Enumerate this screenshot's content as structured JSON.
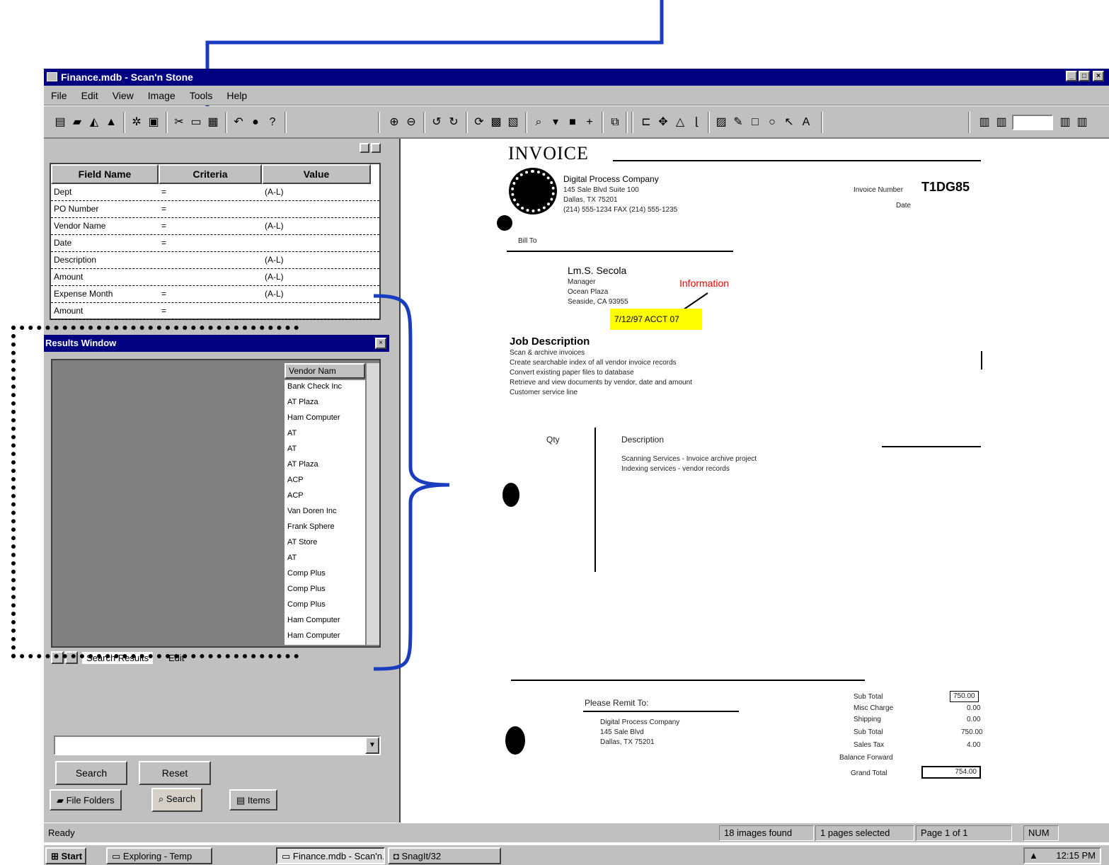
{
  "window": {
    "title": "Finance.mdb - Scan'n Stone",
    "min": "_",
    "max": "□",
    "close": "×"
  },
  "menu": [
    "File",
    "Edit",
    "View",
    "Image",
    "Tools",
    "Help"
  ],
  "grid": {
    "headers": [
      "Field Name",
      "Criteria",
      "Value"
    ],
    "rows": [
      {
        "field": "Dept",
        "criteria": "=",
        "value": "(A-L)"
      },
      {
        "field": "PO Number",
        "criteria": "=",
        "value": ""
      },
      {
        "field": "Vendor Name",
        "criteria": "=",
        "value": "(A-L)"
      },
      {
        "field": "Date",
        "criteria": "=",
        "value": ""
      },
      {
        "field": "Description",
        "criteria": "",
        "value": "(A-L)"
      },
      {
        "field": "Amount",
        "criteria": "",
        "value": "(A-L)"
      },
      {
        "field": "Expense Month",
        "criteria": "=",
        "value": "(A-L)"
      },
      {
        "field": "Amount",
        "criteria": "=",
        "value": ""
      }
    ]
  },
  "results": {
    "title": "Results Window",
    "header": "Vendor Nam",
    "items": [
      "Bank Check Inc",
      "AT Plaza",
      "Ham Computer",
      "AT",
      "AT",
      "AT Plaza",
      "ACP",
      "ACP",
      "Van Doren Inc",
      "Frank Sphere",
      "AT Store",
      "AT",
      "Comp Plus",
      "Comp Plus",
      "Comp Plus",
      "Ham Computer",
      "Ham Computer"
    ],
    "tabs": {
      "search_results": "Search Results",
      "edit": "Edit"
    }
  },
  "search": {
    "combo_value": "",
    "search_btn": "Search",
    "reset_btn": "Reset",
    "tabs": [
      "File Folders",
      "Search",
      "Items"
    ]
  },
  "doc": {
    "title": "INVOICE",
    "company": "Digital Process Company",
    "company_lines": [
      "145 Sale Blvd Suite 100",
      "Dallas, TX 75201",
      "(214) 555-1234 FAX (214) 555-1235"
    ],
    "invoice_label": "Invoice Number",
    "invoice_no": "T1DG85",
    "date_label": "Date",
    "bill_label": "Bill To",
    "bill_name": "Lm.S. Secola",
    "bill_lines": [
      "Manager",
      "Ocean Plaza",
      "Seaside, CA 93955"
    ],
    "annotation": "Information",
    "note": "7/12/97 ACCT 07",
    "job_title": "Job Description",
    "job_lines": [
      "Scan & archive invoices",
      "Create searchable index of all vendor invoice records",
      "Convert existing paper files to database",
      "Retrieve and view documents by vendor, date and amount",
      "Customer service line"
    ],
    "col_qty": "Qty",
    "col_desc": "Description",
    "desc_lines": [
      "Scanning Services - Invoice archive project",
      "Indexing services - vendor records"
    ],
    "pay_label": "Please Remit To:",
    "pay_lines": [
      "Digital Process Company",
      "145 Sale Blvd",
      "Dallas, TX 75201"
    ],
    "totals": [
      {
        "l": "Sub Total",
        "v": "750.00"
      },
      {
        "l": "Misc Charge",
        "v": "0.00"
      },
      {
        "l": "Shipping",
        "v": "0.00"
      },
      {
        "l": "Sub Total",
        "v": "750.00"
      },
      {
        "l": "Sales Tax",
        "v": "4.00"
      },
      {
        "l": "Balance Forward",
        "v": ""
      }
    ],
    "grand_label": "Grand Total",
    "grand": "754.00"
  },
  "status": {
    "ready": "Ready",
    "images": "18 images found",
    "pages": "1 pages selected",
    "page": "Page 1 of 1",
    "mode": "NUM"
  },
  "taskbar": {
    "start": "Start",
    "items": [
      "Exploring - Temp",
      "Finance.mdb - Scan'n...",
      "SnagIt/32"
    ],
    "clock": "12:15 PM"
  },
  "colors": {
    "title_bg": "#000080",
    "face": "#c0c0c0",
    "arrow": "#1a3dbf",
    "annotation": "#ff0000",
    "highlight": "#ffff00"
  }
}
